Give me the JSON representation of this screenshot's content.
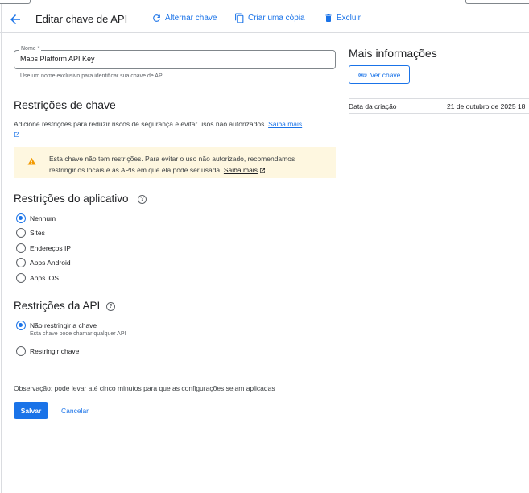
{
  "toolbar": {
    "title": "Editar chave de API",
    "rotate_label": "Alternar chave",
    "copy_label": "Criar uma cópia",
    "delete_label": "Excluir"
  },
  "name_field": {
    "label": "Nome *",
    "value": "Maps Platform API Key",
    "hint": "Use um nome exclusivo para identificar sua chave de API"
  },
  "key_restrictions": {
    "title": "Restrições de chave",
    "description": "Adicione restrições para reduzir riscos de segurança e evitar usos não autorizados.",
    "learn_more": "Saiba mais",
    "warning_text": "Esta chave não tem restrições. Para evitar o uso não autorizado, recomendamos restringir os locais e as APIs em que ela pode ser usada.",
    "warning_link": "Saiba mais"
  },
  "app_restrictions": {
    "title": "Restrições do aplicativo",
    "options": [
      {
        "label": "Nenhum",
        "checked": true
      },
      {
        "label": "Sites",
        "checked": false
      },
      {
        "label": "Endereços IP",
        "checked": false
      },
      {
        "label": "Apps Android",
        "checked": false
      },
      {
        "label": "Apps iOS",
        "checked": false
      }
    ]
  },
  "api_restrictions": {
    "title": "Restrições da API",
    "options": [
      {
        "label": "Não restringir a chave",
        "sublabel": "Esta chave pode chamar qualquer API",
        "checked": true
      },
      {
        "label": "Restringir chave",
        "sublabel": "",
        "checked": false
      }
    ]
  },
  "footer": {
    "note": "Observação: pode levar até cinco minutos para que as configurações sejam aplicadas",
    "save_label": "Salvar",
    "cancel_label": "Cancelar"
  },
  "side_panel": {
    "title": "Mais informações",
    "view_key_label": "Ver chave",
    "creation_label": "Data da criação",
    "creation_value": "21 de outubro de 2025 18"
  },
  "icons": {
    "back": "arrow-back-icon",
    "rotate": "refresh-icon",
    "copy": "copy-icon",
    "delete": "trash-icon",
    "warning": "warning-icon",
    "help": "help-icon",
    "external": "external-link-icon",
    "key": "key-icon"
  },
  "colors": {
    "accent": "#1a73e8",
    "warning_bg": "#fef7e0",
    "warning_icon": "#f29900"
  }
}
